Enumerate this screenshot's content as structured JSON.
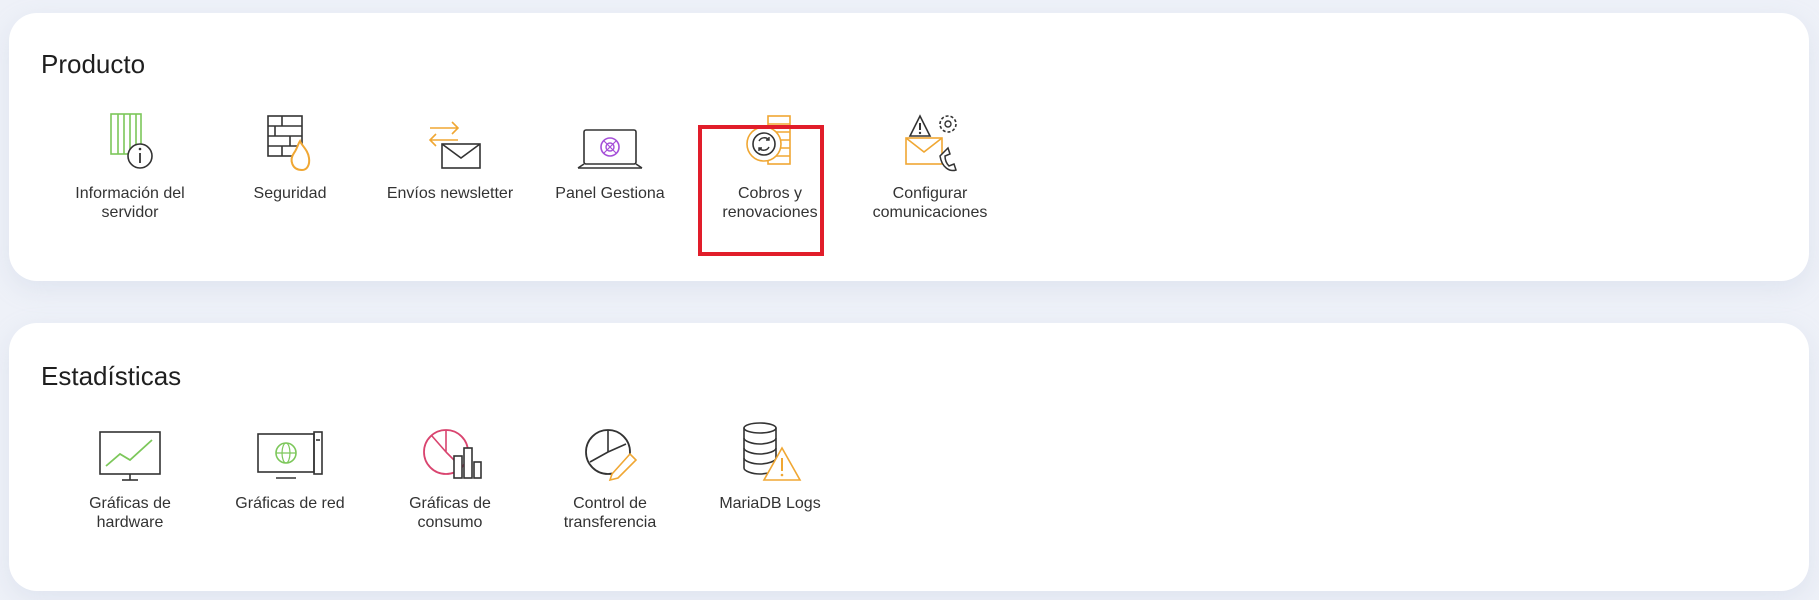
{
  "sections": [
    {
      "title": "Producto",
      "items": [
        {
          "label": "Información del servidor",
          "icon": "server-info-icon"
        },
        {
          "label": "Seguridad",
          "icon": "firewall-icon"
        },
        {
          "label": "Envíos newsletter",
          "icon": "newsletter-icon"
        },
        {
          "label": "Panel Gestiona",
          "icon": "panel-monitor-icon"
        },
        {
          "label": "Cobros y renovaciones",
          "icon": "billing-renewal-icon",
          "selected": true
        },
        {
          "label": "Configurar comunicaciones",
          "icon": "communications-settings-icon"
        }
      ]
    },
    {
      "title": "Estadísticas",
      "items": [
        {
          "label": "Gráficas de hardware",
          "icon": "hardware-chart-icon"
        },
        {
          "label": "Gráficas de red",
          "icon": "network-chart-icon"
        },
        {
          "label": "Gráficas de consumo",
          "icon": "consumption-chart-icon"
        },
        {
          "label": "Control de transferencia",
          "icon": "transfer-control-icon"
        },
        {
          "label": "MariaDB Logs",
          "icon": "database-logs-icon"
        }
      ]
    }
  ],
  "colors": {
    "accent_orange": "#f0a733",
    "accent_green": "#7cc75a",
    "accent_purple": "#a54fd8",
    "accent_pink": "#d9446f",
    "selection_red": "#e11d2a"
  }
}
